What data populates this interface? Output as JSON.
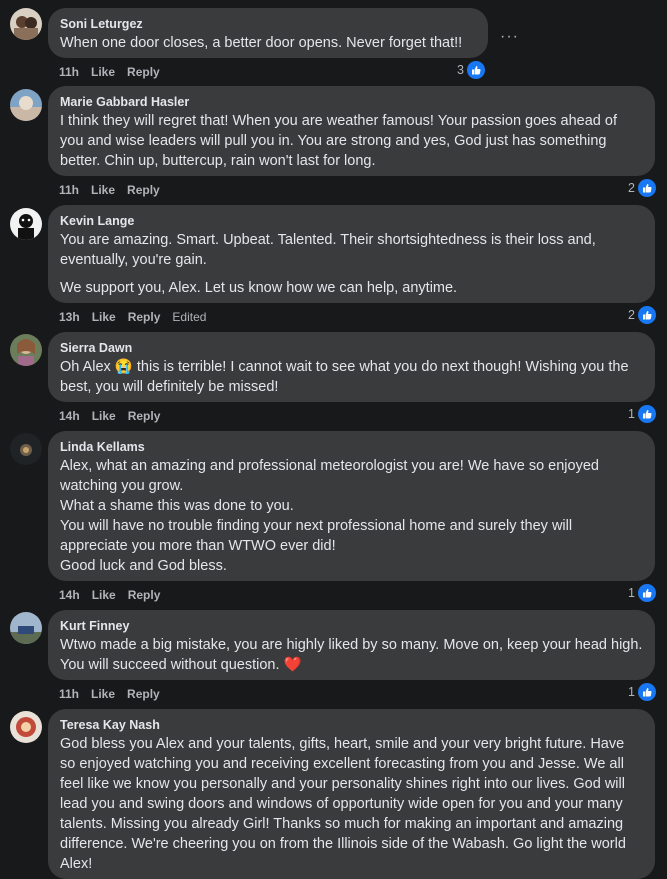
{
  "comments": [
    {
      "author": "Soni Leturgez",
      "paragraphs": [
        "When one door closes, a better door opens. Never forget that!!"
      ],
      "time": "11h",
      "like": "Like",
      "reply": "Reply",
      "edited": "",
      "reactions": "3"
    },
    {
      "author": "Marie Gabbard Hasler",
      "paragraphs": [
        "I think they will regret that! When you are weather famous! Your passion goes ahead of you and wise leaders will pull you in. You are strong and yes, God just has something better. Chin up, buttercup, rain won't last for long."
      ],
      "time": "11h",
      "like": "Like",
      "reply": "Reply",
      "edited": "",
      "reactions": "2"
    },
    {
      "author": "Kevin Lange",
      "paragraphs": [
        "You are amazing. Smart. Upbeat. Talented. Their shortsightedness is their loss and, eventually, you're gain.",
        "We support you, Alex. Let us know how we can help, anytime."
      ],
      "time": "13h",
      "like": "Like",
      "reply": "Reply",
      "edited": "Edited",
      "reactions": "2"
    },
    {
      "author": "Sierra Dawn",
      "paragraphs": [
        "Oh Alex 😭 this is terrible! I cannot wait to see what you do next though! Wishing you the best, you will definitely be missed!"
      ],
      "time": "14h",
      "like": "Like",
      "reply": "Reply",
      "edited": "",
      "reactions": "1"
    },
    {
      "author": "Linda Kellams",
      "paragraphs": [
        "Alex, what an amazing and professional meteorologist you are! We have so enjoyed watching you grow.\nWhat a shame this was done to you.\nYou will have no trouble finding your next professional home and surely they will appreciate you more than WTWO ever did!\nGood luck and God bless."
      ],
      "time": "14h",
      "like": "Like",
      "reply": "Reply",
      "edited": "",
      "reactions": "1"
    },
    {
      "author": "Kurt Finney",
      "paragraphs": [
        "Wtwo made a big mistake, you are highly liked by so many. Move on, keep your head high. You will succeed without question. ❤️"
      ],
      "time": "11h",
      "like": "Like",
      "reply": "Reply",
      "edited": "",
      "reactions": "1"
    },
    {
      "author": "Teresa Kay Nash",
      "paragraphs": [
        "God bless you Alex and your talents, gifts, heart, smile and your very bright future. Have so enjoyed watching you and receiving excellent forecasting from you and Jesse. We all feel like we know you personally and your personality shines right into our lives. God will lead you and swing doors and windows of opportunity wide open for you and your many talents. Missing you already Girl! Thanks so much for making an important and amazing difference. We're cheering you on from the Illinois side of the Wabash. Go light the world Alex!"
      ],
      "time": "",
      "like": "",
      "reply": "",
      "edited": "",
      "reactions": ""
    }
  ],
  "more_options": "···",
  "colors": {
    "background": "#18191a",
    "bubble": "#3a3b3c",
    "text": "#e4e6eb",
    "secondary_text": "#b0b3b8",
    "like_blue": "#1877f2"
  },
  "icons": {
    "like_reaction": "thumbs-up-icon",
    "more": "more-options-icon"
  }
}
